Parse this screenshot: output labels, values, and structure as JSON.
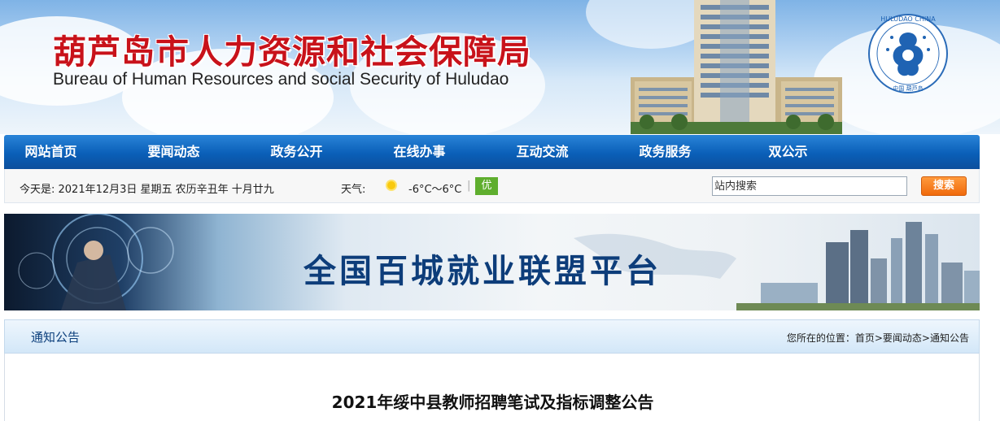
{
  "header": {
    "title_cn": "葫芦岛市人力资源和社会保障局",
    "title_en": "Bureau of Human Resources and social Security of Huludao",
    "emblem_text": "HULUDAO CHINA",
    "emblem_sub": "中国 葫芦岛",
    "brand_color": "#c8121a"
  },
  "nav": {
    "items": [
      {
        "label": "网站首页"
      },
      {
        "label": "要闻动态"
      },
      {
        "label": "政务公开"
      },
      {
        "label": "在线办事"
      },
      {
        "label": "互动交流"
      },
      {
        "label": "政务服务"
      },
      {
        "label": "双公示"
      }
    ]
  },
  "infobar": {
    "date_text": "今天是:  2021年12月3日 星期五 农历辛丑年 十月廿九",
    "weather_label": "天气:",
    "weather_icon": "sun-icon",
    "temperature": "-6°C～6°C",
    "separator": "|",
    "aqi": "优",
    "aqi_color": "#5fae2e",
    "search_placeholder": "站内搜索",
    "search_button": "搜索"
  },
  "banner": {
    "text": "全国百城就业联盟平台"
  },
  "section": {
    "title": "通知公告",
    "breadcrumb_prefix": "您所在的位置：",
    "breadcrumb": [
      "首页",
      "要闻动态",
      "通知公告"
    ],
    "breadcrumb_sep": ">"
  },
  "article": {
    "title": "2021年绥中县教师招聘笔试及指标调整公告"
  }
}
